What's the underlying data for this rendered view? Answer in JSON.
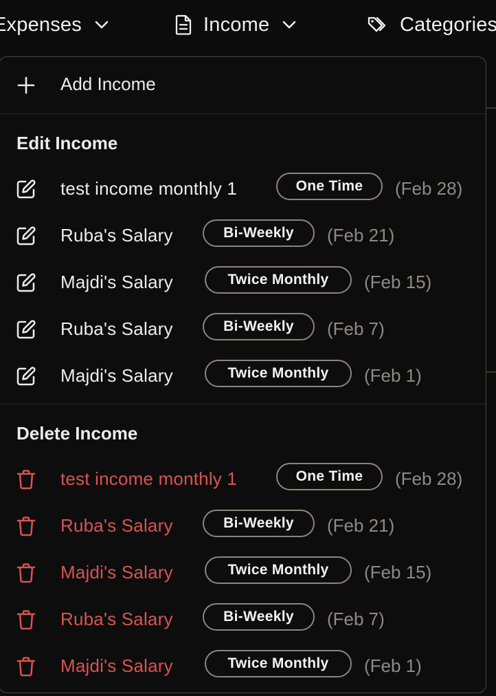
{
  "nav": {
    "expenses_label": "Expenses",
    "income_label": "Income",
    "categories_label": "Categories"
  },
  "menu": {
    "add_label": "Add Income",
    "edit_section_title": "Edit Income",
    "delete_section_title": "Delete Income",
    "edit_items": [
      {
        "name": "test income monthly 1",
        "frequency": "One Time",
        "date": "(Feb 28)"
      },
      {
        "name": "Ruba's Salary",
        "frequency": "Bi-Weekly",
        "date": "(Feb 21)"
      },
      {
        "name": "Majdi's Salary",
        "frequency": "Twice Monthly",
        "date": "(Feb 15)"
      },
      {
        "name": "Ruba's Salary",
        "frequency": "Bi-Weekly",
        "date": "(Feb 7)"
      },
      {
        "name": "Majdi's Salary",
        "frequency": "Twice Monthly",
        "date": "(Feb 1)"
      }
    ],
    "delete_items": [
      {
        "name": "test income monthly 1",
        "frequency": "One Time",
        "date": "(Feb 28)"
      },
      {
        "name": "Ruba's Salary",
        "frequency": "Bi-Weekly",
        "date": "(Feb 21)"
      },
      {
        "name": "Majdi's Salary",
        "frequency": "Twice Monthly",
        "date": "(Feb 15)"
      },
      {
        "name": "Ruba's Salary",
        "frequency": "Bi-Weekly",
        "date": "(Feb 7)"
      },
      {
        "name": "Majdi's Salary",
        "frequency": "Twice Monthly",
        "date": "(Feb 1)"
      }
    ]
  },
  "icons": {
    "nav_chevron": "chevron-down-icon",
    "income_icon": "document-icon",
    "categories_icon": "tags-icon",
    "add_icon": "plus-icon",
    "edit_icon": "edit-icon",
    "delete_icon": "trash-icon"
  },
  "colors": {
    "background": "#0c0c0d",
    "panel_border": "#4a4640",
    "text": "#ececec",
    "muted_date": "#8e8a84",
    "badge_border": "#8c8679",
    "delete_red": "#d9534f"
  }
}
